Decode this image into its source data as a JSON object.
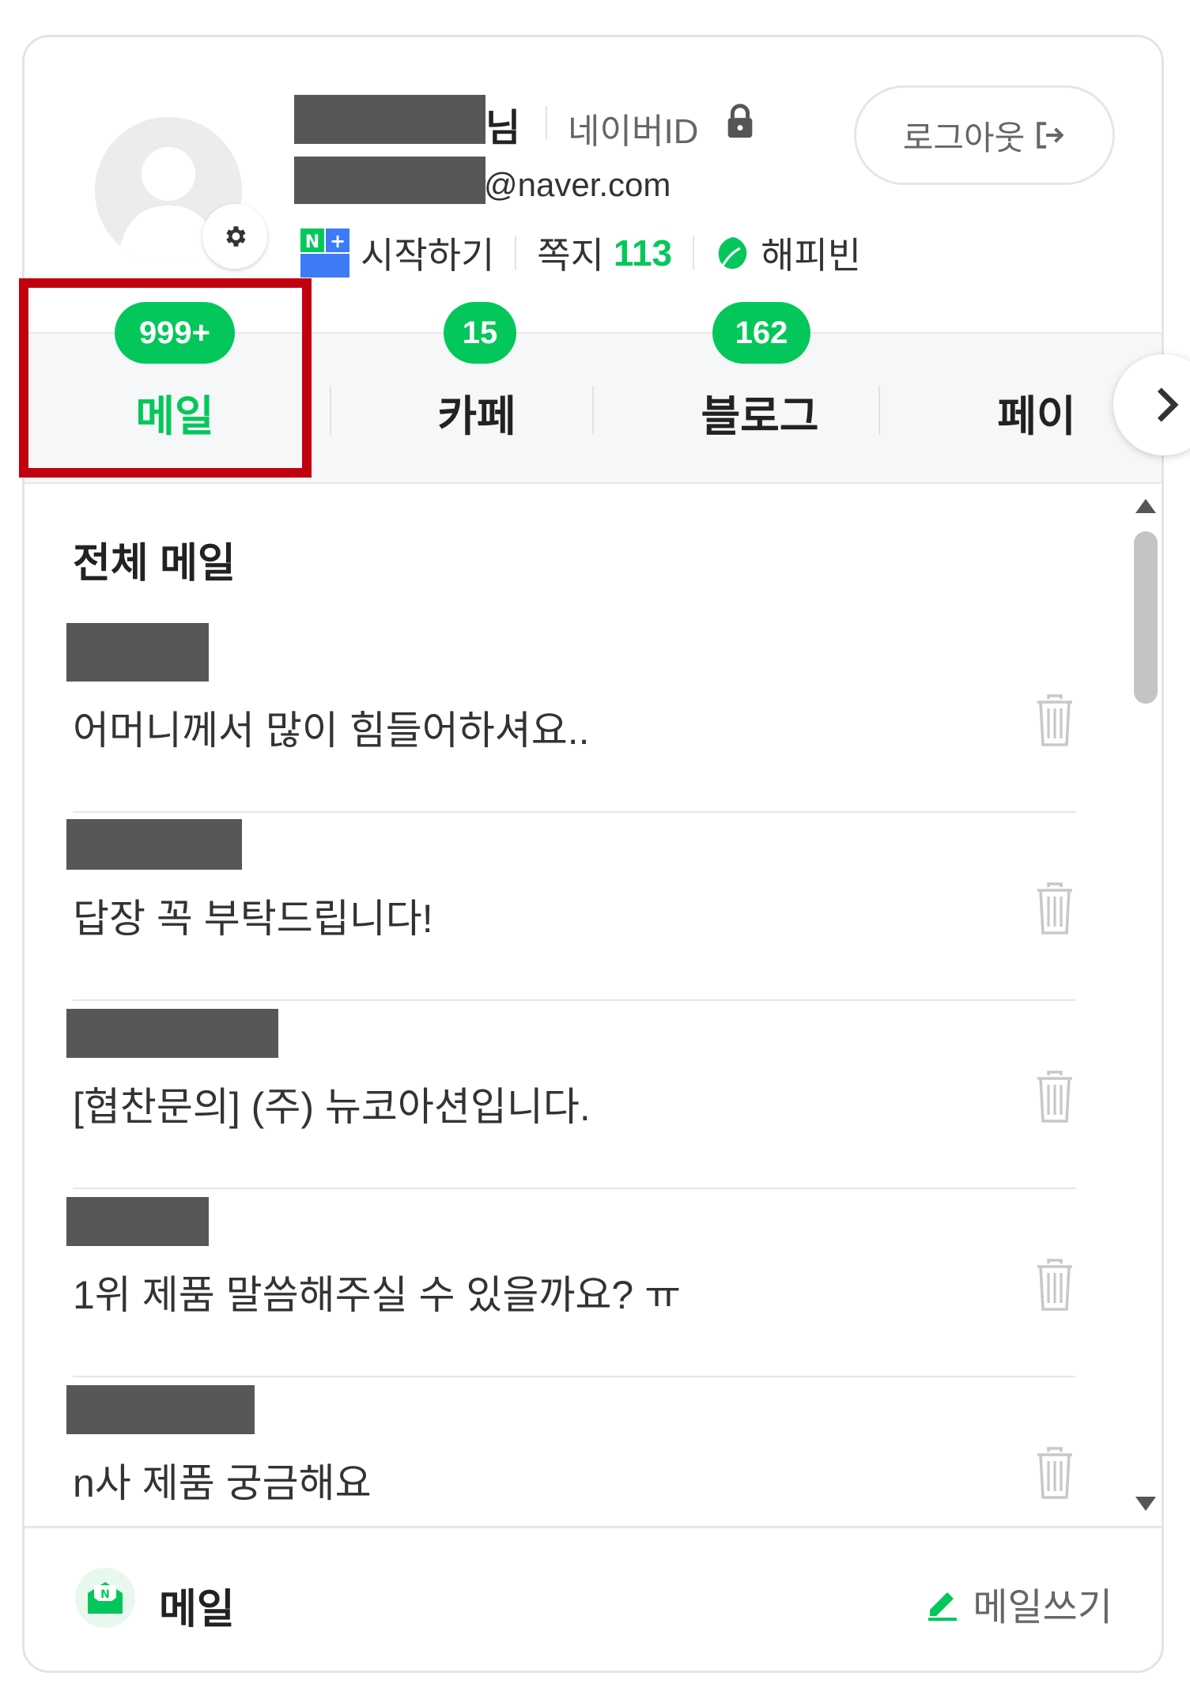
{
  "profile": {
    "name_suffix": "님",
    "naver_id_label": "네이버ID",
    "email_domain": "@naver.com",
    "logout_label": "로그아웃",
    "sub_links": {
      "start": "시작하기",
      "notes_label": "쪽지",
      "notes_count": "113",
      "happybean": "해피빈"
    }
  },
  "tabs": [
    {
      "label": "메일",
      "badge": "999+",
      "active": true
    },
    {
      "label": "카페",
      "badge": "15",
      "active": false
    },
    {
      "label": "블로그",
      "badge": "162",
      "active": false
    },
    {
      "label": "페이",
      "badge": "",
      "active": false
    }
  ],
  "mail_list": {
    "title": "전체 메일",
    "items": [
      {
        "subject": "어머니께서 많이 힘들어하셔요.."
      },
      {
        "subject": "답장 꼭 부탁드립니다!"
      },
      {
        "subject": "[협찬문의] (주) 뉴코아션입니다."
      },
      {
        "subject": "1위 제품 말씀해주실 수 있을까요? ㅠ"
      },
      {
        "subject": "n사 제품 궁금해요"
      }
    ]
  },
  "footer": {
    "service_label": "메일",
    "compose_label": "메일쓰기"
  },
  "colors": {
    "accent": "#03c75a",
    "highlight": "#c10010",
    "redaction": "#575757"
  },
  "icons": [
    "avatar-placeholder-icon",
    "gear-icon",
    "lock-icon",
    "logout-arrow-icon",
    "nplus-membership-icon",
    "happybean-leaf-icon",
    "chevron-right-icon",
    "trash-icon",
    "mail-logo-icon",
    "pencil-icon"
  ]
}
